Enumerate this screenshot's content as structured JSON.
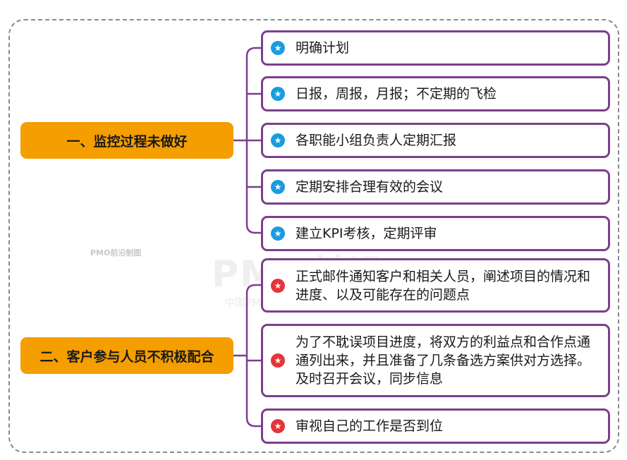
{
  "branches": [
    {
      "label": "一、监控过程未做好",
      "items": [
        {
          "text": "明确计划",
          "icon": "blue-star-icon"
        },
        {
          "text": "日报，周报，月报；不定期的飞检",
          "icon": "blue-star-icon"
        },
        {
          "text": "各职能小组负责人定期汇报",
          "icon": "blue-star-icon"
        },
        {
          "text": "定期安排合理有效的会议",
          "icon": "blue-star-icon"
        },
        {
          "text": "建立KPI考核，定期评审",
          "icon": "blue-star-icon"
        }
      ]
    },
    {
      "label": "二、客户参与人员不积极配合",
      "items": [
        {
          "text": "正式邮件通知客户和相关人员，阐述项目的情况和进度、以及可能存在的问题点",
          "icon": "red-star-icon"
        },
        {
          "text": "为了不耽误项目进度，将双方的利益点和合作点通通列出来，并且准备了几条备选方案供对方选择。及时召开会议，同步信息",
          "icon": "red-star-icon"
        },
        {
          "text": "审视自己的工作是否到位",
          "icon": "red-star-icon"
        }
      ]
    }
  ],
  "watermark": {
    "small": "PMO前沿制图",
    "big": "PMO前沿",
    "sub": "中国PMO及PM社区"
  },
  "colors": {
    "branch_fill": "#f59e00",
    "leaf_border": "#7b3f8c",
    "connector": "#7b3f8c",
    "star_blue": "#1b9be0",
    "star_red": "#e5343a"
  }
}
